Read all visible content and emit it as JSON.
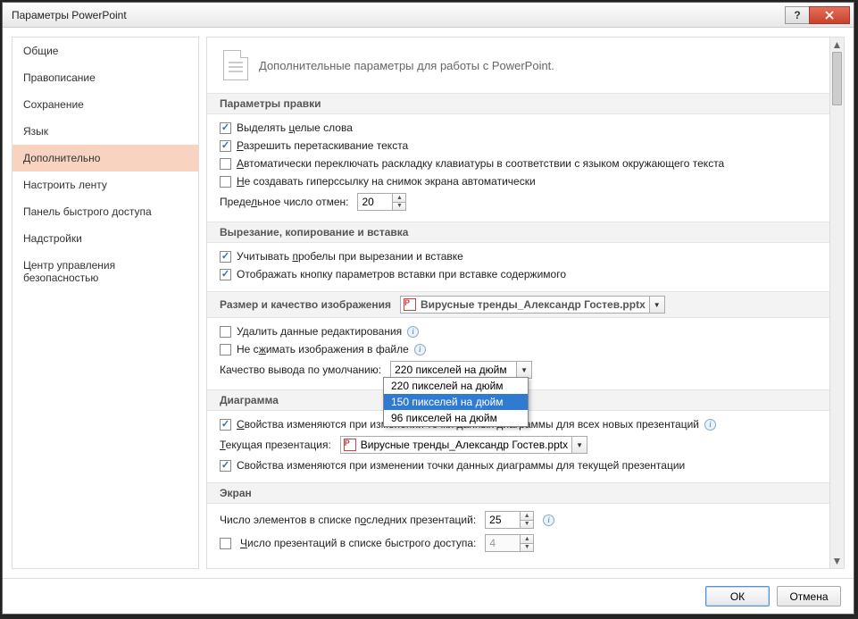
{
  "window": {
    "title": "Параметры PowerPoint"
  },
  "sidebar": {
    "items": [
      {
        "label": "Общие"
      },
      {
        "label": "Правописание"
      },
      {
        "label": "Сохранение"
      },
      {
        "label": "Язык"
      },
      {
        "label": "Дополнительно",
        "selected": true
      },
      {
        "label": "Настроить ленту"
      },
      {
        "label": "Панель быстрого доступа"
      },
      {
        "label": "Надстройки"
      },
      {
        "label": "Центр управления безопасностью"
      }
    ]
  },
  "header": {
    "text": "Дополнительные параметры для работы с PowerPoint."
  },
  "sections": {
    "editing": {
      "title": "Параметры правки",
      "select_whole_words": "Выделять целые слова",
      "allow_drag": "Разрешить перетаскивание текста",
      "auto_keyboard_layout": "Автоматически переключать раскладку клавиатуры в соответствии с языком окружающего текста",
      "no_hyperlink_screenshot": "Не создавать гиперссылку на снимок экрана автоматически",
      "undo_limit_label": "Предельное число отмен:",
      "undo_limit_value": "20"
    },
    "cutcopy": {
      "title": "Вырезание, копирование и вставка",
      "smart_spaces": "Учитывать пробелы при вырезании и вставке",
      "show_paste_options": "Отображать кнопку параметров вставки при вставке содержимого"
    },
    "image": {
      "title": "Размер и качество изображения",
      "file": "Вирусные тренды_Александр Гостев.pptx",
      "discard_editing": "Удалить данные редактирования",
      "no_compress": "Не сжимать изображения в файле",
      "default_quality_label": "Качество вывода по умолчанию:",
      "default_quality_value": "220 пикселей на дюйм",
      "quality_options": [
        "220 пикселей на дюйм",
        "150 пикселей на дюйм",
        "96 пикселей на дюйм"
      ],
      "quality_selected_index": 1
    },
    "chart": {
      "title": "Диаграмма",
      "props_all_new": "Свойства изменяются при изменении точки данных диаграммы для всех новых презентаций",
      "current_label": "Текущая презентация:",
      "current_file": "Вирусные тренды_Александр Гостев.pptx",
      "props_current": "Свойства изменяются при изменении точки данных диаграммы для текущей презентации"
    },
    "screen": {
      "title": "Экран",
      "recent_count_label": "Число элементов в списке последних презентаций:",
      "recent_count_value": "25",
      "quick_count_label": "Число презентаций в списке быстрого доступа:",
      "quick_count_value": "4"
    }
  },
  "footer": {
    "ok": "ОК",
    "cancel": "Отмена"
  }
}
